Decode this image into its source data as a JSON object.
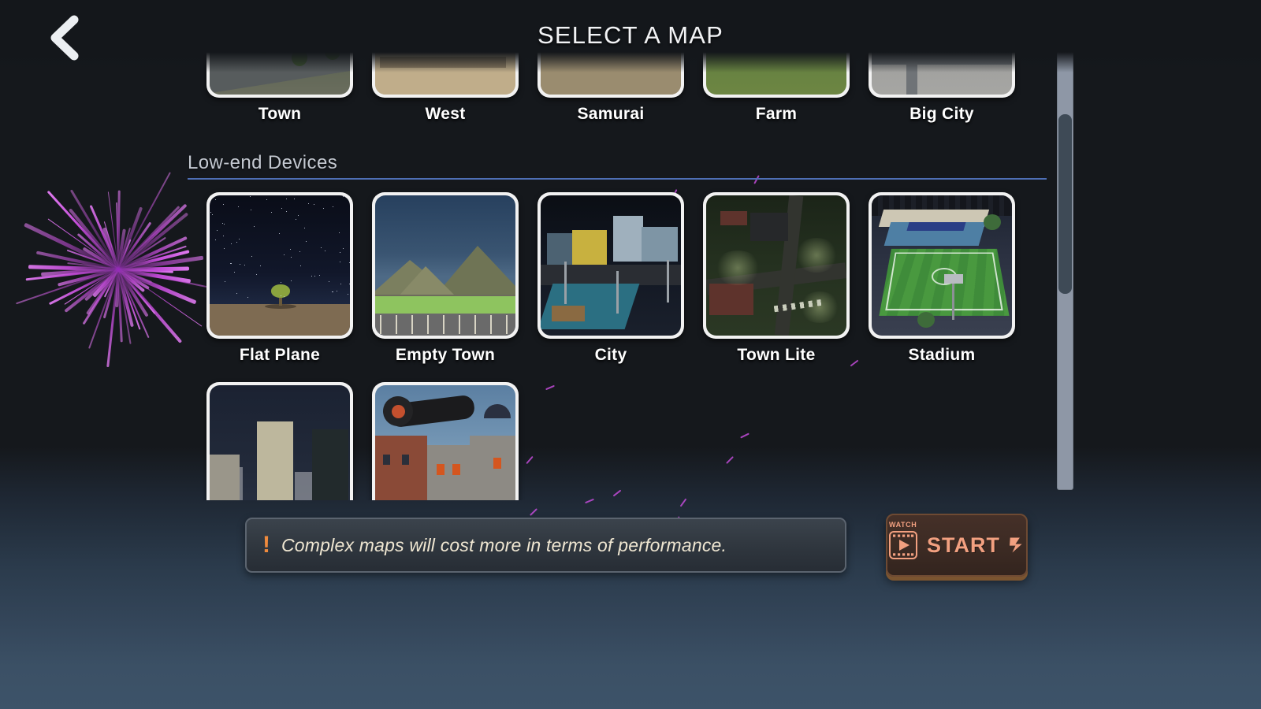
{
  "header": {
    "title": "SELECT A MAP",
    "back_icon": "chevron-left-icon"
  },
  "sections": [
    {
      "title": "",
      "maps": [
        {
          "label": "Town",
          "scene": "sc-town"
        },
        {
          "label": "West",
          "scene": "sc-west"
        },
        {
          "label": "Samurai",
          "scene": "sc-samurai"
        },
        {
          "label": "Farm",
          "scene": "sc-farm"
        },
        {
          "label": "Big City",
          "scene": "sc-bigcity"
        }
      ]
    },
    {
      "title": "Low-end Devices",
      "maps": [
        {
          "label": "Flat Plane",
          "scene": "sc-flat"
        },
        {
          "label": "Empty Town",
          "scene": "sc-empty"
        },
        {
          "label": "City",
          "scene": "sc-city"
        },
        {
          "label": "Town Lite",
          "scene": "sc-lite"
        },
        {
          "label": "Stadium",
          "scene": "sc-stadium"
        }
      ]
    },
    {
      "title": "",
      "maps": [
        {
          "label": "",
          "scene": "sc-skyline"
        },
        {
          "label": "",
          "scene": "sc-cannon"
        }
      ]
    }
  ],
  "warning": {
    "icon": "exclamation-mark",
    "text": "Complex maps will cost more in terms of performance."
  },
  "start": {
    "watch_label": "WATCH",
    "label": "START",
    "video_icon": "video-play-icon",
    "arrow_icon": "double-chevron-right-icon"
  },
  "scrollbar": {
    "orientation": "vertical"
  },
  "colors": {
    "accent_blue": "#4e6fb5",
    "start_text": "#f2a080",
    "warning_icon": "#ef8a3d",
    "warning_text": "#f0e7d2",
    "firework": "#c24bd8",
    "background_top": "#15181c",
    "background_bottom": "#3d5369"
  }
}
